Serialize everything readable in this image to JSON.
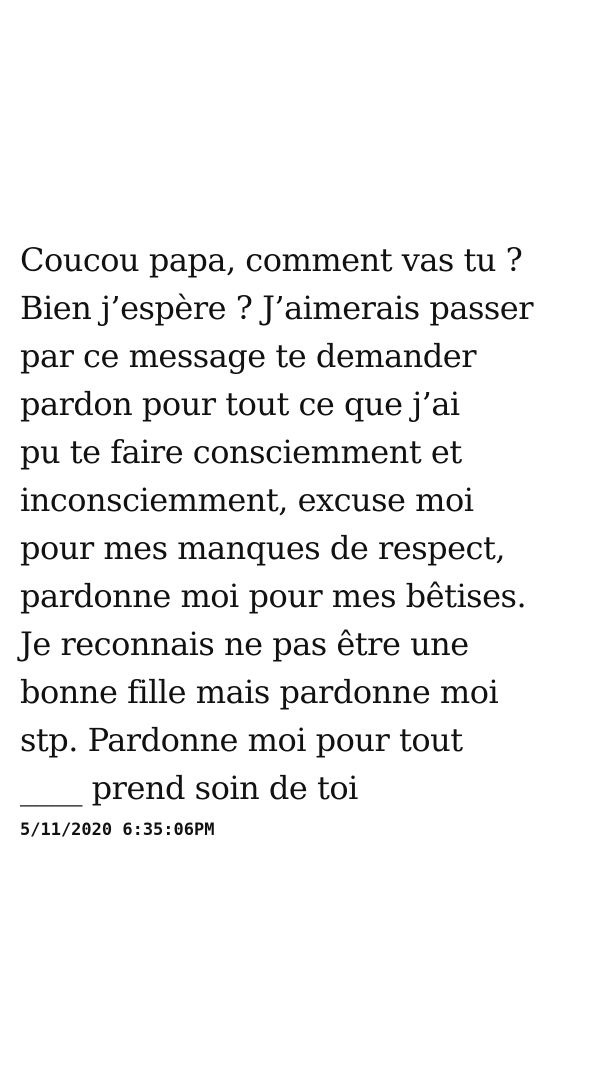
{
  "message": {
    "lines": [
      "Coucou papa, comment vas tu ?",
      "Bien j’espère ? J’aimerais passer",
      "par ce message te demander",
      "pardon pour tout ce que j’ai",
      "pu te faire consciemment et",
      "inconsciemment, excuse moi",
      "pour mes manques de respect,",
      "pardonne moi pour mes bêtises.",
      "Je reconnais ne pas être une",
      "bonne fille mais pardonne moi",
      "stp. Pardonne moi pour tout",
      "____ prend soin de toi"
    ]
  },
  "timestamp": "5/11/2020 6:35:06PM",
  "colors": {
    "background": "#ffffff",
    "text": "#111111"
  }
}
